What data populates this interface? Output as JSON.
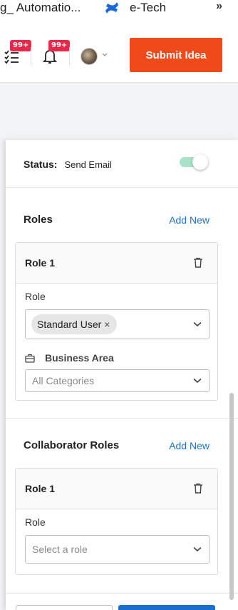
{
  "bookmarks": {
    "item1": "g_ Automatio...",
    "item2": "e-Tech",
    "more": "»"
  },
  "header": {
    "tasks_badge": "99+",
    "notifications_badge": "99+",
    "submit_label": "Submit Idea",
    "submit_color": "#f04a1a"
  },
  "panel": {
    "status_label": "Status:",
    "status_value": "Send Email",
    "toggle_on": true,
    "roles": {
      "title": "Roles",
      "add_new": "Add New",
      "card_title": "Role 1",
      "role_label": "Role",
      "role_chip": "Standard User",
      "chip_remove": "×",
      "business_area_label": "Business Area",
      "business_area_placeholder": "All Categories"
    },
    "collaborator_roles": {
      "title": "Collaborator Roles",
      "add_new": "Add New",
      "card_title": "Role 1",
      "role_label": "Role",
      "role_placeholder": "Select a role"
    }
  },
  "colors": {
    "accent_link": "#1a73c8",
    "toggle_track": "#a6e3c8",
    "badge": "#e8284a"
  }
}
